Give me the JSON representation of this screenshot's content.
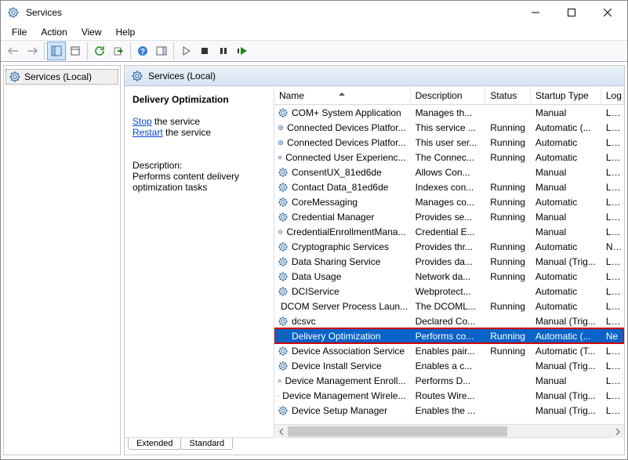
{
  "window": {
    "title": "Services"
  },
  "menu": {
    "file": "File",
    "action": "Action",
    "view": "View",
    "help": "Help"
  },
  "tree": {
    "root": "Services (Local)"
  },
  "panel": {
    "heading": "Services (Local)"
  },
  "info": {
    "selected_name": "Delivery Optimization",
    "stop_link": "Stop",
    "stop_suffix": " the service",
    "restart_link": "Restart",
    "restart_suffix": " the service",
    "desc_label": "Description:",
    "desc_text": "Performs content delivery optimization tasks"
  },
  "columns": {
    "name": "Name",
    "desc": "Description",
    "status": "Status",
    "startup": "Startup Type",
    "logon": "Log"
  },
  "services": [
    {
      "name": "COM+ System Application",
      "desc": "Manages th...",
      "status": "",
      "startup": "Manual",
      "logon": "Loc"
    },
    {
      "name": "Connected Devices Platfor...",
      "desc": "This service ...",
      "status": "Running",
      "startup": "Automatic (...",
      "logon": "Loc"
    },
    {
      "name": "Connected Devices Platfor...",
      "desc": "This user ser...",
      "status": "Running",
      "startup": "Automatic",
      "logon": "Loc"
    },
    {
      "name": "Connected User Experienc...",
      "desc": "The Connec...",
      "status": "Running",
      "startup": "Automatic",
      "logon": "Loc"
    },
    {
      "name": "ConsentUX_81ed6de",
      "desc": "Allows Con...",
      "status": "",
      "startup": "Manual",
      "logon": "Loc"
    },
    {
      "name": "Contact Data_81ed6de",
      "desc": "Indexes con...",
      "status": "Running",
      "startup": "Manual",
      "logon": "Loc"
    },
    {
      "name": "CoreMessaging",
      "desc": "Manages co...",
      "status": "Running",
      "startup": "Automatic",
      "logon": "Loc"
    },
    {
      "name": "Credential Manager",
      "desc": "Provides se...",
      "status": "Running",
      "startup": "Manual",
      "logon": "Loc"
    },
    {
      "name": "CredentialEnrollmentMana...",
      "desc": "Credential E...",
      "status": "",
      "startup": "Manual",
      "logon": "Loc"
    },
    {
      "name": "Cryptographic Services",
      "desc": "Provides thr...",
      "status": "Running",
      "startup": "Automatic",
      "logon": "Net"
    },
    {
      "name": "Data Sharing Service",
      "desc": "Provides da...",
      "status": "Running",
      "startup": "Manual (Trig...",
      "logon": "Loc"
    },
    {
      "name": "Data Usage",
      "desc": "Network da...",
      "status": "Running",
      "startup": "Automatic",
      "logon": "Loc"
    },
    {
      "name": "DCIService",
      "desc": "Webprotect...",
      "status": "",
      "startup": "Automatic",
      "logon": "Loc"
    },
    {
      "name": "DCOM Server Process Laun...",
      "desc": "The DCOML...",
      "status": "Running",
      "startup": "Automatic",
      "logon": "Loc"
    },
    {
      "name": "dcsvc",
      "desc": "Declared Co...",
      "status": "",
      "startup": "Manual (Trig...",
      "logon": "Loc"
    },
    {
      "name": "Delivery Optimization",
      "desc": "Performs co...",
      "status": "Running",
      "startup": "Automatic (...",
      "logon": "Ne",
      "selected": true
    },
    {
      "name": "Device Association Service",
      "desc": "Enables pair...",
      "status": "Running",
      "startup": "Automatic (T...",
      "logon": "Loc"
    },
    {
      "name": "Device Install Service",
      "desc": "Enables a c...",
      "status": "",
      "startup": "Manual (Trig...",
      "logon": "Loc"
    },
    {
      "name": "Device Management Enroll...",
      "desc": "Performs D...",
      "status": "",
      "startup": "Manual",
      "logon": "Loc"
    },
    {
      "name": "Device Management Wirele...",
      "desc": "Routes Wire...",
      "status": "",
      "startup": "Manual (Trig...",
      "logon": "Loc"
    },
    {
      "name": "Device Setup Manager",
      "desc": "Enables the ...",
      "status": "",
      "startup": "Manual (Trig...",
      "logon": "Loc"
    }
  ],
  "tabs": {
    "extended": "Extended",
    "standard": "Standard"
  }
}
